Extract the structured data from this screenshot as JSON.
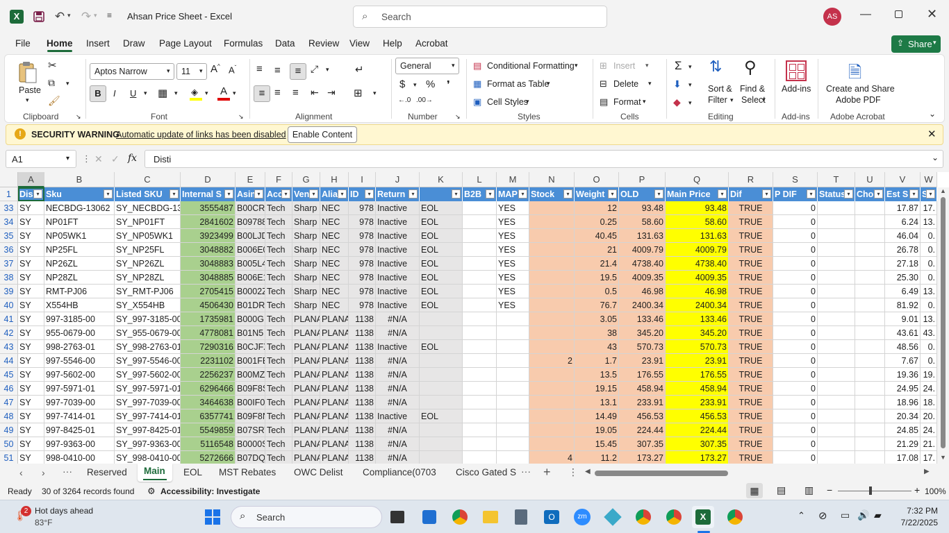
{
  "title": {
    "doc_title": "Ahsan Price Sheet",
    "app": "Excel",
    "separator": " - ",
    "search_placeholder": "Search",
    "avatar": "AS",
    "share": "Share"
  },
  "menu": [
    "File",
    "Home",
    "Insert",
    "Draw",
    "Page Layout",
    "Formulas",
    "Data",
    "Review",
    "View",
    "Help",
    "Acrobat"
  ],
  "ribbon": {
    "paste": "Paste",
    "clipboard": "Clipboard",
    "font_name": "Aptos Narrow",
    "font_size": "11",
    "bold": "B",
    "italic": "I",
    "underline": "U",
    "font": "Font",
    "alignment": "Alignment",
    "number_format": "General",
    "number": "Number",
    "conditional_formatting": "Conditional Formatting",
    "format_as_table": "Format as Table",
    "cell_styles": "Cell Styles",
    "styles": "Styles",
    "insert": "Insert",
    "delete": "Delete",
    "format": "Format",
    "cells": "Cells",
    "sort_filter_1": "Sort &",
    "sort_filter_2": "Filter",
    "find_select_1": "Find &",
    "find_select_2": "Select",
    "editing": "Editing",
    "addins": "Add-ins",
    "addins_group": "Add-ins",
    "create_pdf_1": "Create and Share",
    "create_pdf_2": "Adobe PDF",
    "adobe_acrobat": "Adobe Acrobat"
  },
  "security": {
    "label": "SECURITY WARNING",
    "message": "Automatic update of links has been disabled",
    "button": "Enable Content"
  },
  "formula": {
    "name_box": "A1",
    "fx": "fx",
    "value": "Disti"
  },
  "columns": [
    "A",
    "B",
    "C",
    "D",
    "E",
    "F",
    "G",
    "H",
    "I",
    "J",
    "K",
    "L",
    "M",
    "N",
    "O",
    "P",
    "Q",
    "R",
    "S",
    "T",
    "U",
    "V",
    "W"
  ],
  "headers": [
    "Dis",
    "Sku",
    "Listed SKU",
    "Internal S",
    "Asin",
    "Acc",
    "Ven",
    "Alia",
    "ID",
    "Return",
    "",
    "B2B",
    "MAP",
    "Stock",
    "Weight",
    "OLD",
    "Main Price",
    "Dif",
    "P DIF",
    "Status",
    "Cho",
    "Est S",
    "Sh"
  ],
  "rows": [
    {
      "n": "33",
      "c": [
        "SY",
        "NECBDG-13062",
        "SY_NECBDG-13062",
        "3555487",
        "B00CR…",
        "Tech",
        "Sharp",
        "NEC",
        "978",
        "Inactive",
        "EOL",
        "",
        "YES",
        "",
        "12",
        "93.48",
        "93.48",
        "TRUE",
        "0",
        "",
        "",
        "17.87",
        "17."
      ]
    },
    {
      "n": "34",
      "c": [
        "SY",
        "NP01FT",
        "SY_NP01FT",
        "2841602",
        "B09788",
        "Tech",
        "Sharp",
        "NEC",
        "978",
        "Inactive",
        "EOL",
        "",
        "YES",
        "",
        "0.25",
        "58.60",
        "58.60",
        "TRUE",
        "0",
        "",
        "",
        "6.24",
        "13."
      ]
    },
    {
      "n": "35",
      "c": [
        "SY",
        "NP05WK1",
        "SY_NP05WK1",
        "3923499",
        "B00LJD",
        "Tech",
        "Sharp",
        "NEC",
        "978",
        "Inactive",
        "EOL",
        "",
        "YES",
        "",
        "40.45",
        "131.63",
        "131.63",
        "TRUE",
        "0",
        "",
        "",
        "46.04",
        "0."
      ]
    },
    {
      "n": "36",
      "c": [
        "SY",
        "NP25FL",
        "SY_NP25FL",
        "3048882",
        "B006E0",
        "Tech",
        "Sharp",
        "NEC",
        "978",
        "Inactive",
        "EOL",
        "",
        "YES",
        "",
        "21",
        "4009.79",
        "4009.79",
        "TRUE",
        "0",
        "",
        "",
        "26.78",
        "0."
      ]
    },
    {
      "n": "37",
      "c": [
        "SY",
        "NP26ZL",
        "SY_NP26ZL",
        "3048883",
        "B005L4",
        "Tech",
        "Sharp",
        "NEC",
        "978",
        "Inactive",
        "EOL",
        "",
        "YES",
        "",
        "21.4",
        "4738.40",
        "4738.40",
        "TRUE",
        "0",
        "",
        "",
        "27.18",
        "0."
      ]
    },
    {
      "n": "38",
      "c": [
        "SY",
        "NP28ZL",
        "SY_NP28ZL",
        "3048885",
        "B006E1",
        "Tech",
        "Sharp",
        "NEC",
        "978",
        "Inactive",
        "EOL",
        "",
        "YES",
        "",
        "19.5",
        "4009.35",
        "4009.35",
        "TRUE",
        "0",
        "",
        "",
        "25.30",
        "0."
      ]
    },
    {
      "n": "39",
      "c": [
        "SY",
        "RMT-PJ06",
        "SY_RMT-PJ06",
        "2705415",
        "B0002Z",
        "Tech",
        "Sharp",
        "NEC",
        "978",
        "Inactive",
        "EOL",
        "",
        "YES",
        "",
        "0.5",
        "46.98",
        "46.98",
        "TRUE",
        "0",
        "",
        "",
        "6.49",
        "13."
      ]
    },
    {
      "n": "40",
      "c": [
        "SY",
        "X554HB",
        "SY_X554HB",
        "4506430",
        "B01DR",
        "Tech",
        "Sharp",
        "NEC",
        "978",
        "Inactive",
        "EOL",
        "",
        "YES",
        "",
        "76.7",
        "2400.34",
        "2400.34",
        "TRUE",
        "0",
        "",
        "",
        "81.92",
        "0."
      ]
    },
    {
      "n": "41",
      "c": [
        "SY",
        "997-3185-00",
        "SY_997-3185-00",
        "1735981",
        "B000G",
        "Tech",
        "PLANA",
        "PLANA",
        "1138",
        "#N/A",
        "",
        "",
        "",
        "",
        "3.05",
        "133.46",
        "133.46",
        "TRUE",
        "0",
        "",
        "",
        "9.01",
        "13."
      ]
    },
    {
      "n": "42",
      "c": [
        "SY",
        "955-0679-00",
        "SY_955-0679-00",
        "4778081",
        "B01N5",
        "Tech",
        "PLANA",
        "PLANA",
        "1138",
        "#N/A",
        "",
        "",
        "",
        "",
        "38",
        "345.20",
        "345.20",
        "TRUE",
        "0",
        "",
        "",
        "43.61",
        "43."
      ]
    },
    {
      "n": "43",
      "c": [
        "SY",
        "998-2763-01",
        "SY_998-2763-01",
        "7290316",
        "B0CJFX",
        "Tech",
        "PLANA",
        "PLANA",
        "1138",
        "Inactive",
        "EOL",
        "",
        "",
        "",
        "43",
        "570.73",
        "570.73",
        "TRUE",
        "0",
        "",
        "",
        "48.56",
        "0."
      ]
    },
    {
      "n": "44",
      "c": [
        "SY",
        "997-5546-00",
        "SY_997-5546-00",
        "2231102",
        "B001FE",
        "Tech",
        "PLANA",
        "PLANA",
        "1138",
        "#N/A",
        "",
        "",
        "",
        "2",
        "1.7",
        "23.91",
        "23.91",
        "TRUE",
        "0",
        "",
        "",
        "7.67",
        "0."
      ]
    },
    {
      "n": "45",
      "c": [
        "SY",
        "997-5602-00",
        "SY_997-5602-00",
        "2256237",
        "B00MZ",
        "Tech",
        "PLANA",
        "PLANA",
        "1138",
        "#N/A",
        "",
        "",
        "",
        "",
        "13.5",
        "176.55",
        "176.55",
        "TRUE",
        "0",
        "",
        "",
        "19.36",
        "19."
      ]
    },
    {
      "n": "46",
      "c": [
        "SY",
        "997-5971-01",
        "SY_997-5971-01",
        "6296466",
        "B09F8S",
        "Tech",
        "PLANA",
        "PLANA",
        "1138",
        "#N/A",
        "",
        "",
        "",
        "",
        "19.15",
        "458.94",
        "458.94",
        "TRUE",
        "0",
        "",
        "",
        "24.95",
        "24."
      ]
    },
    {
      "n": "47",
      "c": [
        "SY",
        "997-7039-00",
        "SY_997-7039-00",
        "3464638",
        "B00IF0",
        "Tech",
        "PLANA",
        "PLANA",
        "1138",
        "#N/A",
        "",
        "",
        "",
        "",
        "13.1",
        "233.91",
        "233.91",
        "TRUE",
        "0",
        "",
        "",
        "18.96",
        "18."
      ]
    },
    {
      "n": "48",
      "c": [
        "SY",
        "997-7414-01",
        "SY_997-7414-01",
        "6357741",
        "B09F8N",
        "Tech",
        "PLANA",
        "PLANA",
        "1138",
        "Inactive",
        "EOL",
        "",
        "",
        "",
        "14.49",
        "456.53",
        "456.53",
        "TRUE",
        "0",
        "",
        "",
        "20.34",
        "20."
      ]
    },
    {
      "n": "49",
      "c": [
        "SY",
        "997-8425-01",
        "SY_997-8425-01",
        "5549859",
        "B07SRV",
        "Tech",
        "PLANA",
        "PLANA",
        "1138",
        "#N/A",
        "",
        "",
        "",
        "",
        "19.05",
        "224.44",
        "224.44",
        "TRUE",
        "0",
        "",
        "",
        "24.85",
        "24."
      ]
    },
    {
      "n": "50",
      "c": [
        "SY",
        "997-9363-00",
        "SY_997-9363-00",
        "5116548",
        "B0000S",
        "Tech",
        "PLANA",
        "PLANA",
        "1138",
        "#N/A",
        "",
        "",
        "",
        "",
        "15.45",
        "307.35",
        "307.35",
        "TRUE",
        "0",
        "",
        "",
        "21.29",
        "21."
      ]
    },
    {
      "n": "51",
      "c": [
        "SY",
        "998-0410-00",
        "SY_998-0410-00",
        "5272666",
        "B07DQ",
        "Tech",
        "PLANA",
        "PLANA",
        "1138",
        "#N/A",
        "",
        "",
        "",
        "4",
        "11.2",
        "173.27",
        "173.27",
        "TRUE",
        "0",
        "",
        "",
        "17.08",
        "17."
      ]
    }
  ],
  "sheets": [
    "Reserved",
    "Main",
    "EOL",
    "MST Rebates",
    "OWC Delist",
    "Compliance(0703",
    "Cisco Gated S"
  ],
  "active_sheet": "Main",
  "status": {
    "ready": "Ready",
    "records": "30 of 3264 records found",
    "accessibility": "Accessibility: Investigate",
    "zoom": "100%"
  },
  "taskbar": {
    "weather_badge": "2",
    "weather_title": "Hot days ahead",
    "weather_temp": "83°F",
    "search": "Search",
    "time": "7:32 PM",
    "date": "7/22/2025"
  },
  "colors": {
    "header_blue": "#4a8ed6",
    "green_fill": "#a9d08e",
    "gray_fill": "#e7e6e6",
    "peach_fill": "#f8cbad",
    "yellow_fill": "#ffff00",
    "excel_green": "#1d6b3a"
  }
}
